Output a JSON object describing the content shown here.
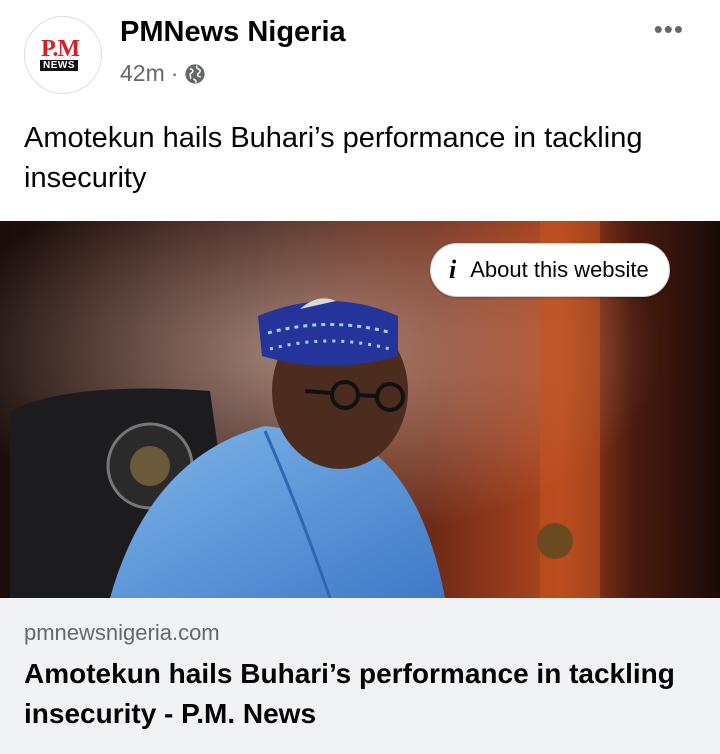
{
  "post": {
    "page_name": "PMNews Nigeria",
    "timestamp": "42m",
    "separator": "·",
    "visibility_icon": "globe-icon",
    "more_icon": "more-options-icon",
    "more_glyph": "•••",
    "caption": "Amotekun hails Buhari’s performance in tackling insecurity"
  },
  "avatar": {
    "logo_text_top": "P.M",
    "logo_text_bottom": "NEWS"
  },
  "image": {
    "about_button_label": "About this website",
    "about_icon": "info-icon"
  },
  "link": {
    "domain": "pmnewsnigeria.com",
    "title": "Amotekun hails Buhari’s performance in tackling insecurity - P.M. News"
  },
  "colors": {
    "brand_red": "#d71f26",
    "meta_gray": "#65676b",
    "link_background": "#f0f2f5"
  }
}
